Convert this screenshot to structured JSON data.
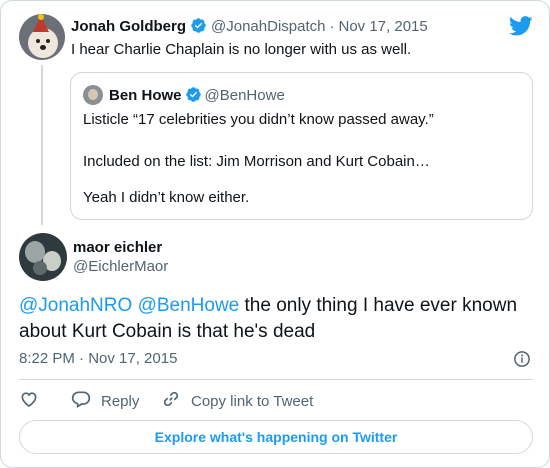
{
  "parent_tweet": {
    "author_name": "Jonah Goldberg",
    "handle": "@JonahDispatch",
    "separator": "·",
    "date": "Nov 17, 2015",
    "text": "I hear Charlie Chaplain is no longer with us as well.",
    "quoted_tweet": {
      "author_name": "Ben Howe",
      "handle": "@BenHowe",
      "lines": [
        "Listicle “17 celebrities you didn’t know passed away.”",
        "Included on the list: Jim Morrison and Kurt Cobain…",
        "Yeah I didn’t know either."
      ]
    }
  },
  "main_tweet": {
    "author_name": "maor eichler",
    "handle": "@EichlerMaor",
    "mention1": "@JonahNRO",
    "mention2": "@BenHowe",
    "text": " the only thing I have ever known about Kurt Cobain is that he's dead",
    "timestamp": "8:22 PM · Nov 17, 2015"
  },
  "actions": {
    "reply_label": "Reply",
    "copy_label": "Copy link to Tweet"
  },
  "explore_label": "Explore what's happening on Twitter",
  "colors": {
    "accent": "#1d9bf0",
    "text": "#0f1419",
    "muted": "#536471",
    "border": "#cfd9de"
  },
  "icons": [
    "verified-badge-icon",
    "twitter-bird-icon",
    "info-icon",
    "heart-icon",
    "reply-icon",
    "link-icon"
  ]
}
